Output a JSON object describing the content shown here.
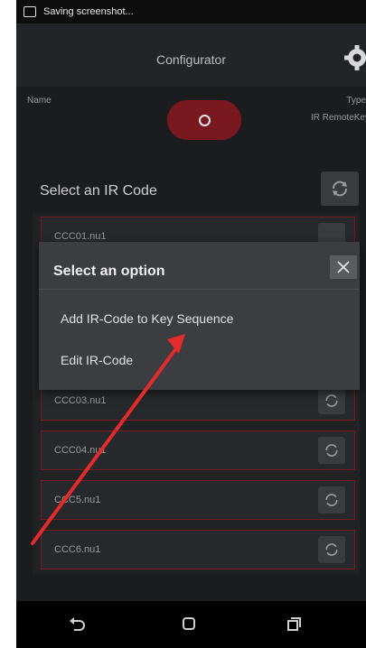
{
  "status": {
    "text": "Saving screenshot..."
  },
  "app": {
    "title": "Configurator"
  },
  "fields": {
    "name_label": "Name",
    "type_label": "Type",
    "type_value": "IR RemoteKey"
  },
  "list": {
    "title": "Select an IR Code",
    "items": [
      {
        "label": "CCC01.nu1"
      },
      {
        "label": "CCC03.nu1"
      },
      {
        "label": "CCC04.nu1"
      },
      {
        "label": "CCC5.nu1"
      },
      {
        "label": "CCC6.nu1"
      }
    ]
  },
  "dialog": {
    "title": "Select an option",
    "options": [
      "Add IR-Code to Key Sequence",
      "Edit IR-Code"
    ]
  },
  "colors": {
    "accent": "#7a1820",
    "arrow": "#e32b2b"
  }
}
